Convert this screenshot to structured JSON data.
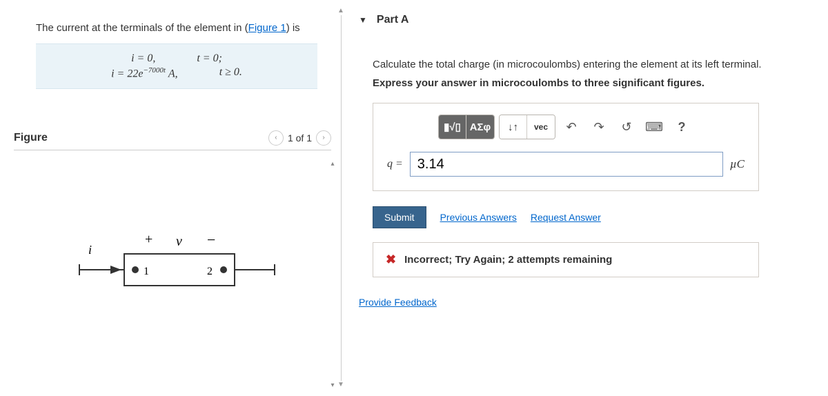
{
  "problem": {
    "intro_pre": "The current at the terminals of the element in (",
    "fig_link": "Figure 1",
    "intro_post": ") is",
    "eq1a": "i = 0,",
    "eq1b": "t = 0;",
    "eq2a_html": "i = 22e<sup>−7000t</sup> A,",
    "eq2b": "t ≥ 0.",
    "figure_label": "Figure",
    "pager": "1 of 1"
  },
  "figure": {
    "i": "i",
    "plus": "+",
    "v": "v",
    "minus": "−",
    "node1": "1",
    "node2": "2"
  },
  "part": {
    "title": "Part A",
    "prompt1": "Calculate the total charge (in microcoulombs) entering the element at its left terminal.",
    "prompt2": "Express your answer in microcoulombs to three significant figures.",
    "var": "q =",
    "value": "3.14",
    "unit": "µC",
    "submit": "Submit",
    "prev": "Previous Answers",
    "req": "Request Answer",
    "feedback": "Incorrect; Try Again; 2 attempts remaining",
    "provide": "Provide Feedback"
  },
  "toolbar": {
    "templates": "▮√▯",
    "symbols": "ΑΣφ",
    "subsup": "↓↑",
    "vec": "vec",
    "undo": "↶",
    "redo": "↷",
    "reset": "↺",
    "keyboard": "⌨",
    "help": "?"
  }
}
